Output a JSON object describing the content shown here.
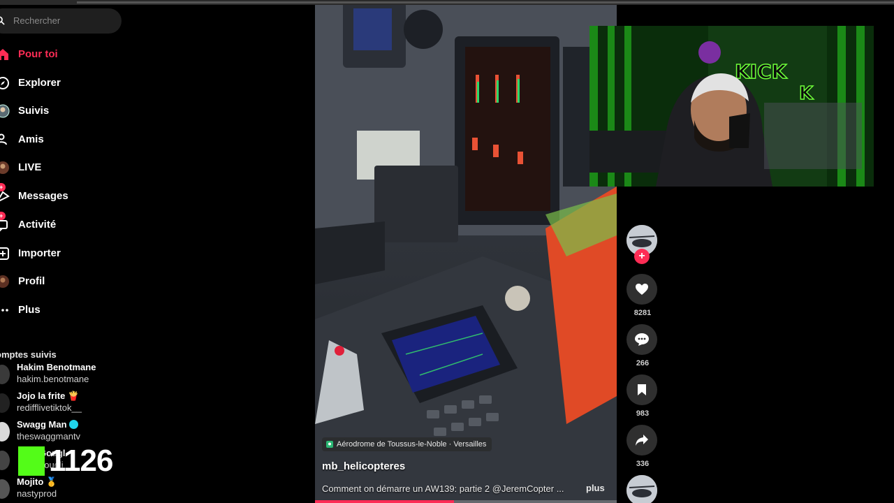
{
  "search": {
    "placeholder": "Rechercher"
  },
  "nav": {
    "items": [
      {
        "label": "Pour toi",
        "icon": "home-icon",
        "active": true
      },
      {
        "label": "Explorer",
        "icon": "compass-icon"
      },
      {
        "label": "Suivis",
        "icon": "following-avatar-icon"
      },
      {
        "label": "Amis",
        "icon": "friends-icon"
      },
      {
        "label": "LIVE",
        "icon": "live-avatar-icon"
      },
      {
        "label": "Messages",
        "icon": "messages-icon",
        "badge": "9+"
      },
      {
        "label": "Activité",
        "icon": "activity-icon",
        "badge": "9+"
      },
      {
        "label": "Importer",
        "icon": "upload-icon"
      },
      {
        "label": "Profil",
        "icon": "profile-avatar-icon"
      },
      {
        "label": "Plus",
        "icon": "more-icon"
      }
    ]
  },
  "following": {
    "title": "omptes suivis",
    "accounts": [
      {
        "name": "Hakim Benotmane",
        "handle": "hakim.benotmane"
      },
      {
        "name": "Jojo la frite 🍟",
        "handle": "redifflivetiktok__"
      },
      {
        "name": "Swagg Man",
        "handle": "theswaggmantv",
        "verified": true
      },
      {
        "name": "Gougl",
        "handle": "gougli"
      },
      {
        "name": "Mojito 🥇",
        "handle": "nastyprod"
      }
    ]
  },
  "stream_overlay": {
    "viewer_count": "1126",
    "platform_logo": "kick-logo"
  },
  "video": {
    "location": "Aérodrome de Toussus-le-Noble · Versailles",
    "username": "mb_helicopteres",
    "description": "Comment on démarre un AW139: partie 2 @JeremCopter  ...",
    "more_label": "plus",
    "progress": 0.46
  },
  "actions": {
    "likes": "8281",
    "comments": "266",
    "saves": "983",
    "shares": "336"
  },
  "webcam": {
    "sign_text": "KICK",
    "sign_text2": "K"
  },
  "colors": {
    "accent": "#fe2c55",
    "kick_green": "#53fc18"
  }
}
